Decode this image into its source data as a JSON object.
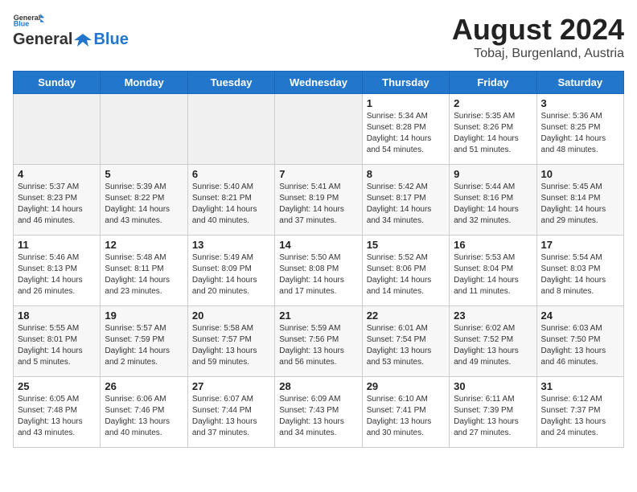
{
  "logo": {
    "line1": "General",
    "line2": "Blue"
  },
  "title": "August 2024",
  "subtitle": "Tobaj, Burgenland, Austria",
  "days_of_week": [
    "Sunday",
    "Monday",
    "Tuesday",
    "Wednesday",
    "Thursday",
    "Friday",
    "Saturday"
  ],
  "weeks": [
    [
      {
        "day": "",
        "info": ""
      },
      {
        "day": "",
        "info": ""
      },
      {
        "day": "",
        "info": ""
      },
      {
        "day": "",
        "info": ""
      },
      {
        "day": "1",
        "info": "Sunrise: 5:34 AM\nSunset: 8:28 PM\nDaylight: 14 hours\nand 54 minutes."
      },
      {
        "day": "2",
        "info": "Sunrise: 5:35 AM\nSunset: 8:26 PM\nDaylight: 14 hours\nand 51 minutes."
      },
      {
        "day": "3",
        "info": "Sunrise: 5:36 AM\nSunset: 8:25 PM\nDaylight: 14 hours\nand 48 minutes."
      }
    ],
    [
      {
        "day": "4",
        "info": "Sunrise: 5:37 AM\nSunset: 8:23 PM\nDaylight: 14 hours\nand 46 minutes."
      },
      {
        "day": "5",
        "info": "Sunrise: 5:39 AM\nSunset: 8:22 PM\nDaylight: 14 hours\nand 43 minutes."
      },
      {
        "day": "6",
        "info": "Sunrise: 5:40 AM\nSunset: 8:21 PM\nDaylight: 14 hours\nand 40 minutes."
      },
      {
        "day": "7",
        "info": "Sunrise: 5:41 AM\nSunset: 8:19 PM\nDaylight: 14 hours\nand 37 minutes."
      },
      {
        "day": "8",
        "info": "Sunrise: 5:42 AM\nSunset: 8:17 PM\nDaylight: 14 hours\nand 34 minutes."
      },
      {
        "day": "9",
        "info": "Sunrise: 5:44 AM\nSunset: 8:16 PM\nDaylight: 14 hours\nand 32 minutes."
      },
      {
        "day": "10",
        "info": "Sunrise: 5:45 AM\nSunset: 8:14 PM\nDaylight: 14 hours\nand 29 minutes."
      }
    ],
    [
      {
        "day": "11",
        "info": "Sunrise: 5:46 AM\nSunset: 8:13 PM\nDaylight: 14 hours\nand 26 minutes."
      },
      {
        "day": "12",
        "info": "Sunrise: 5:48 AM\nSunset: 8:11 PM\nDaylight: 14 hours\nand 23 minutes."
      },
      {
        "day": "13",
        "info": "Sunrise: 5:49 AM\nSunset: 8:09 PM\nDaylight: 14 hours\nand 20 minutes."
      },
      {
        "day": "14",
        "info": "Sunrise: 5:50 AM\nSunset: 8:08 PM\nDaylight: 14 hours\nand 17 minutes."
      },
      {
        "day": "15",
        "info": "Sunrise: 5:52 AM\nSunset: 8:06 PM\nDaylight: 14 hours\nand 14 minutes."
      },
      {
        "day": "16",
        "info": "Sunrise: 5:53 AM\nSunset: 8:04 PM\nDaylight: 14 hours\nand 11 minutes."
      },
      {
        "day": "17",
        "info": "Sunrise: 5:54 AM\nSunset: 8:03 PM\nDaylight: 14 hours\nand 8 minutes."
      }
    ],
    [
      {
        "day": "18",
        "info": "Sunrise: 5:55 AM\nSunset: 8:01 PM\nDaylight: 14 hours\nand 5 minutes."
      },
      {
        "day": "19",
        "info": "Sunrise: 5:57 AM\nSunset: 7:59 PM\nDaylight: 14 hours\nand 2 minutes."
      },
      {
        "day": "20",
        "info": "Sunrise: 5:58 AM\nSunset: 7:57 PM\nDaylight: 13 hours\nand 59 minutes."
      },
      {
        "day": "21",
        "info": "Sunrise: 5:59 AM\nSunset: 7:56 PM\nDaylight: 13 hours\nand 56 minutes."
      },
      {
        "day": "22",
        "info": "Sunrise: 6:01 AM\nSunset: 7:54 PM\nDaylight: 13 hours\nand 53 minutes."
      },
      {
        "day": "23",
        "info": "Sunrise: 6:02 AM\nSunset: 7:52 PM\nDaylight: 13 hours\nand 49 minutes."
      },
      {
        "day": "24",
        "info": "Sunrise: 6:03 AM\nSunset: 7:50 PM\nDaylight: 13 hours\nand 46 minutes."
      }
    ],
    [
      {
        "day": "25",
        "info": "Sunrise: 6:05 AM\nSunset: 7:48 PM\nDaylight: 13 hours\nand 43 minutes."
      },
      {
        "day": "26",
        "info": "Sunrise: 6:06 AM\nSunset: 7:46 PM\nDaylight: 13 hours\nand 40 minutes."
      },
      {
        "day": "27",
        "info": "Sunrise: 6:07 AM\nSunset: 7:44 PM\nDaylight: 13 hours\nand 37 minutes."
      },
      {
        "day": "28",
        "info": "Sunrise: 6:09 AM\nSunset: 7:43 PM\nDaylight: 13 hours\nand 34 minutes."
      },
      {
        "day": "29",
        "info": "Sunrise: 6:10 AM\nSunset: 7:41 PM\nDaylight: 13 hours\nand 30 minutes."
      },
      {
        "day": "30",
        "info": "Sunrise: 6:11 AM\nSunset: 7:39 PM\nDaylight: 13 hours\nand 27 minutes."
      },
      {
        "day": "31",
        "info": "Sunrise: 6:12 AM\nSunset: 7:37 PM\nDaylight: 13 hours\nand 24 minutes."
      }
    ]
  ]
}
